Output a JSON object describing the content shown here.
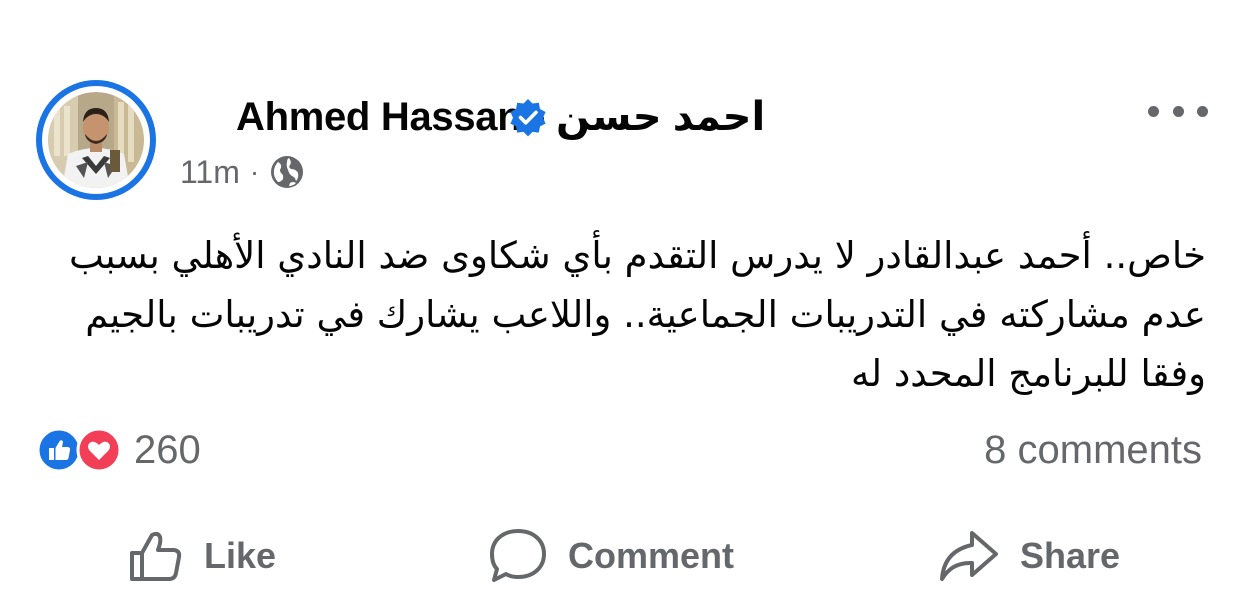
{
  "post": {
    "author": {
      "name": "Ahmed Hassan - احمد حسن",
      "verified": true,
      "avatar": "profile-photo-man-white-graphic-tshirt"
    },
    "timestamp": "11m",
    "separator": "·",
    "audience_icon": "globe-icon",
    "more_icon": "more-options-icon",
    "text": "خاص.. أحمد عبدالقادر لا يدرس التقدم بأي شكاوى ضد النادي الأهلي بسبب عدم مشاركته في التدريبات الجماعية.. واللاعب يشارك في تدريبات بالجيم وفقا للبرنامج المحدد له",
    "reactions": {
      "types": [
        "like",
        "love"
      ],
      "count": "260"
    },
    "comments": "8 comments",
    "actions": {
      "like": "Like",
      "comment": "Comment",
      "share": "Share"
    }
  },
  "colors": {
    "brand_blue": "#1b74e4",
    "secondary_text": "#65676b",
    "primary_text": "#050505",
    "love_red": "#f33e58"
  }
}
